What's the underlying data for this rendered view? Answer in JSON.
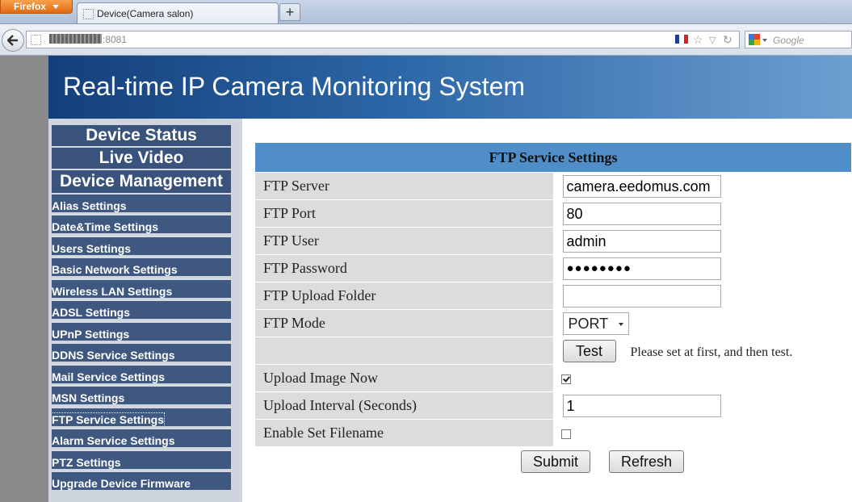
{
  "browser": {
    "menu_label": "Firefox",
    "tab_title": "Device(Camera salon)",
    "new_tab_label": "+",
    "url_port": ":8081",
    "search_placeholder": "Google"
  },
  "colors": {
    "banner_start": "#143f7a",
    "nav_background": "#3e587f",
    "table_header": "#4f8ec8",
    "label_cell": "#dcdcdc"
  },
  "banner": {
    "title": "Real-time IP Camera Monitoring System"
  },
  "sidebar": {
    "sections": [
      {
        "label": "Device Status"
      },
      {
        "label": "Live Video"
      },
      {
        "label": "Device Management"
      }
    ],
    "items": [
      {
        "label": "Alias Settings"
      },
      {
        "label": "Date&Time Settings"
      },
      {
        "label": "Users Settings"
      },
      {
        "label": "Basic Network Settings"
      },
      {
        "label": "Wireless LAN Settings"
      },
      {
        "label": "ADSL Settings"
      },
      {
        "label": "UPnP Settings"
      },
      {
        "label": "DDNS Service Settings"
      },
      {
        "label": "Mail Service Settings"
      },
      {
        "label": "MSN Settings"
      },
      {
        "label": "FTP Service Settings",
        "active": true
      },
      {
        "label": "Alarm Service Settings"
      },
      {
        "label": "PTZ Settings"
      },
      {
        "label": "Upgrade Device Firmware"
      }
    ]
  },
  "ftp": {
    "title": "FTP Service Settings",
    "server_label": "FTP Server",
    "server_value": "camera.eedomus.com",
    "port_label": "FTP Port",
    "port_value": "80",
    "user_label": "FTP User",
    "user_value": "admin",
    "password_label": "FTP Password",
    "password_value": "●●●●●●●●",
    "folder_label": "FTP Upload Folder",
    "folder_value": "",
    "mode_label": "FTP Mode",
    "mode_value": "PORT",
    "test_button": "Test",
    "test_hint": "Please set at first, and then test.",
    "upload_now_label": "Upload Image Now",
    "upload_now_checked": true,
    "interval_label": "Upload Interval (Seconds)",
    "interval_value": "1",
    "filename_label": "Enable Set Filename",
    "filename_checked": false,
    "submit_button": "Submit",
    "refresh_button": "Refresh"
  }
}
